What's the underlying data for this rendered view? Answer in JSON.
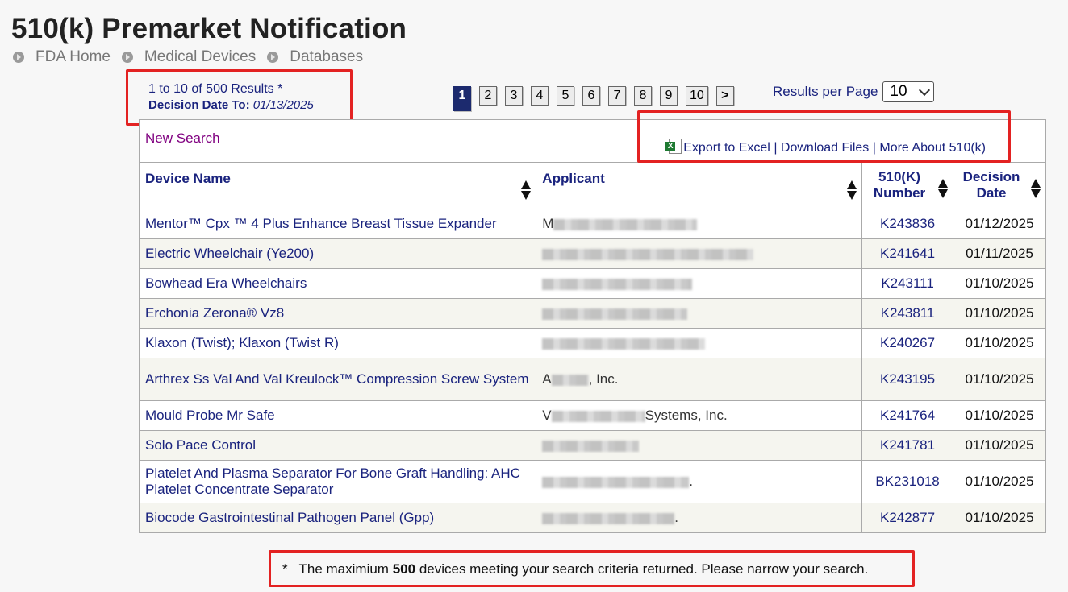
{
  "page": {
    "title": "510(k) Premarket Notification",
    "breadcrumbs": [
      "FDA Home",
      "Medical Devices",
      "Databases"
    ]
  },
  "summary": {
    "results": "1 to 10 of 500 Results *",
    "decision_label": "Decision Date To:",
    "decision_value": "01/13/2025"
  },
  "pagination": {
    "pages": [
      "1",
      "2",
      "3",
      "4",
      "5",
      "6",
      "7",
      "8",
      "9",
      "10"
    ],
    "current": "1",
    "next": ">"
  },
  "results_per_page": {
    "label": "Results per Page",
    "value": "10"
  },
  "toolbar": {
    "new_search": "New Search",
    "export_excel": "Export to Excel",
    "separator": "|",
    "download_files": "Download Files",
    "more_about": "More About 510(k)"
  },
  "columns": {
    "device_name": "Device Name",
    "applicant": "Applicant",
    "k_number_1": "510(K)",
    "k_number_2": "Number",
    "decision_1": "Decision",
    "decision_2": "Date"
  },
  "rows": [
    {
      "device": "Mentor™ Cpx ™ 4 Plus Enhance Breast Tissue Expander",
      "applicant": "M",
      "k": "K243836",
      "date": "01/12/2025"
    },
    {
      "device": "Electric Wheelchair (Ye200)",
      "applicant": "",
      "k": "K241641",
      "date": "01/11/2025"
    },
    {
      "device": "Bowhead Era Wheelchairs",
      "applicant": "",
      "k": "K243111",
      "date": "01/10/2025"
    },
    {
      "device": "Erchonia Zerona® Vz8",
      "applicant": "",
      "k": "K243811",
      "date": "01/10/2025"
    },
    {
      "device": "Klaxon (Twist); Klaxon (Twist R)",
      "applicant": "",
      "k": "K240267",
      "date": "01/10/2025"
    },
    {
      "device": "Arthrex Ss Val And Val Kreulock™ Compression Screw System",
      "applicant": "A",
      "applicant_suffix": ", Inc.",
      "k": "K243195",
      "date": "01/10/2025"
    },
    {
      "device": "Mould Probe Mr Safe",
      "applicant": "V",
      "applicant_suffix": "Systems, Inc.",
      "k": "K241764",
      "date": "01/10/2025"
    },
    {
      "device": "Solo Pace Control",
      "applicant": "",
      "k": "K241781",
      "date": "01/10/2025"
    },
    {
      "device": "Platelet And Plasma Separator For Bone Graft Handling: AHC Platelet Concentrate Separator",
      "applicant": "",
      "applicant_suffix": ".",
      "k": "BK231018",
      "date": "01/10/2025"
    },
    {
      "device": "Biocode Gastrointestinal Pathogen Panel (Gpp)",
      "applicant": "",
      "applicant_suffix": ".",
      "k": "K242877",
      "date": "01/10/2025"
    }
  ],
  "footnote": {
    "star": "*",
    "pre": "The maximium",
    "count": "500",
    "post": "devices meeting your search criteria returned. Please narrow your search."
  },
  "colors": {
    "link": "#1a237e",
    "highlight": "#e32222",
    "active_page": "#1c2a6e"
  }
}
